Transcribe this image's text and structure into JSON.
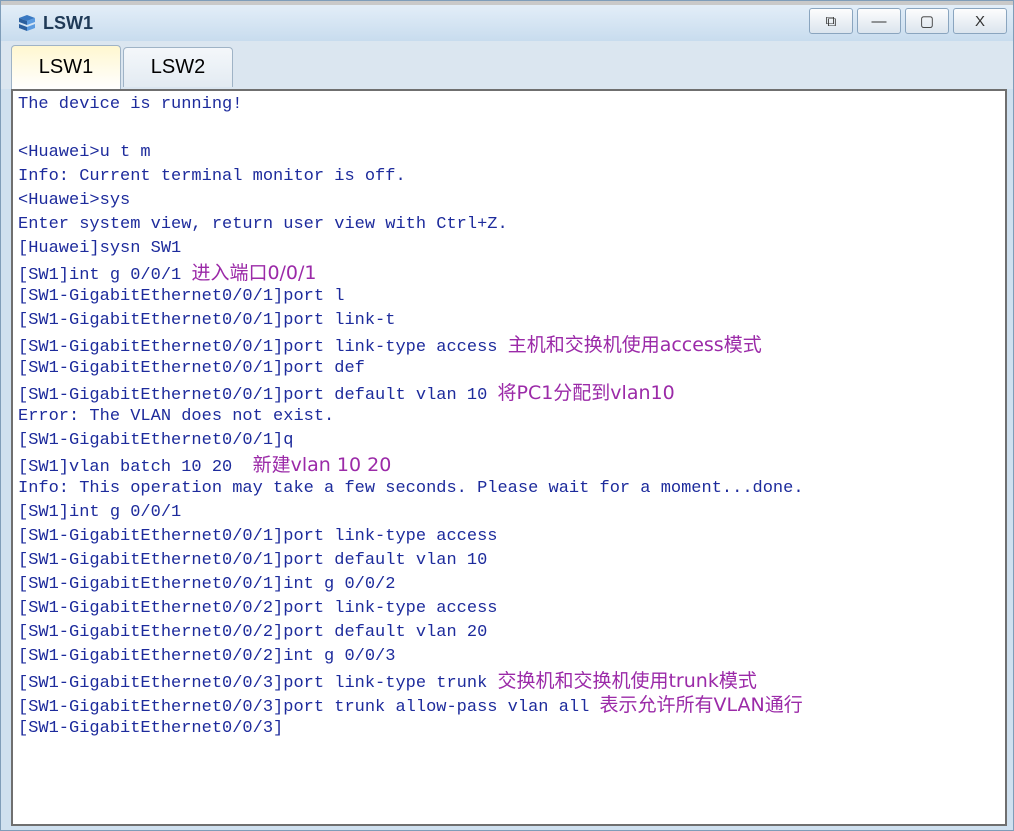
{
  "window": {
    "title": "LSW1",
    "controls": {
      "restore": "⧉",
      "minimize": "—",
      "maximize": "▢",
      "close": "X"
    }
  },
  "tabs": [
    {
      "label": "LSW1",
      "active": true
    },
    {
      "label": "LSW2",
      "active": false
    }
  ],
  "console": {
    "lines": [
      {
        "text": "The device is running!",
        "note": ""
      },
      {
        "text": "",
        "note": ""
      },
      {
        "text": "<Huawei>u t m",
        "note": ""
      },
      {
        "text": "Info: Current terminal monitor is off.",
        "note": ""
      },
      {
        "text": "<Huawei>sys",
        "note": ""
      },
      {
        "text": "Enter system view, return user view with Ctrl+Z.",
        "note": ""
      },
      {
        "text": "[Huawei]sysn SW1",
        "note": ""
      },
      {
        "text": "[SW1]int g 0/0/1 ",
        "note": "进入端口0/0/1"
      },
      {
        "text": "[SW1-GigabitEthernet0/0/1]port l",
        "note": ""
      },
      {
        "text": "[SW1-GigabitEthernet0/0/1]port link-t",
        "note": ""
      },
      {
        "text": "[SW1-GigabitEthernet0/0/1]port link-type access ",
        "note": "主机和交换机使用access模式"
      },
      {
        "text": "[SW1-GigabitEthernet0/0/1]port def",
        "note": ""
      },
      {
        "text": "[SW1-GigabitEthernet0/0/1]port default vlan 10 ",
        "note": "将PC1分配到vlan10"
      },
      {
        "text": "Error: The VLAN does not exist.",
        "note": ""
      },
      {
        "text": "[SW1-GigabitEthernet0/0/1]q",
        "note": ""
      },
      {
        "text": "[SW1]vlan batch 10 20  ",
        "note": "新建vlan 10 20"
      },
      {
        "text": "Info: This operation may take a few seconds. Please wait for a moment...done.",
        "note": ""
      },
      {
        "text": "[SW1]int g 0/0/1",
        "note": ""
      },
      {
        "text": "[SW1-GigabitEthernet0/0/1]port link-type access",
        "note": ""
      },
      {
        "text": "[SW1-GigabitEthernet0/0/1]port default vlan 10",
        "note": ""
      },
      {
        "text": "[SW1-GigabitEthernet0/0/1]int g 0/0/2",
        "note": ""
      },
      {
        "text": "[SW1-GigabitEthernet0/0/2]port link-type access",
        "note": ""
      },
      {
        "text": "[SW1-GigabitEthernet0/0/2]port default vlan 20",
        "note": ""
      },
      {
        "text": "[SW1-GigabitEthernet0/0/2]int g 0/0/3",
        "note": ""
      },
      {
        "text": "[SW1-GigabitEthernet0/0/3]port link-type trunk ",
        "note": "交换机和交换机使用trunk模式"
      },
      {
        "text": "[SW1-GigabitEthernet0/0/3]port trunk allow-pass vlan all ",
        "note": "表示允许所有VLAN通行"
      },
      {
        "text": "[SW1-GigabitEthernet0/0/3]",
        "note": ""
      }
    ]
  },
  "colors": {
    "command_text": "#1d2b9c",
    "annotation_text": "#9b2aa8"
  },
  "icons": {
    "app": "switch-icon"
  }
}
